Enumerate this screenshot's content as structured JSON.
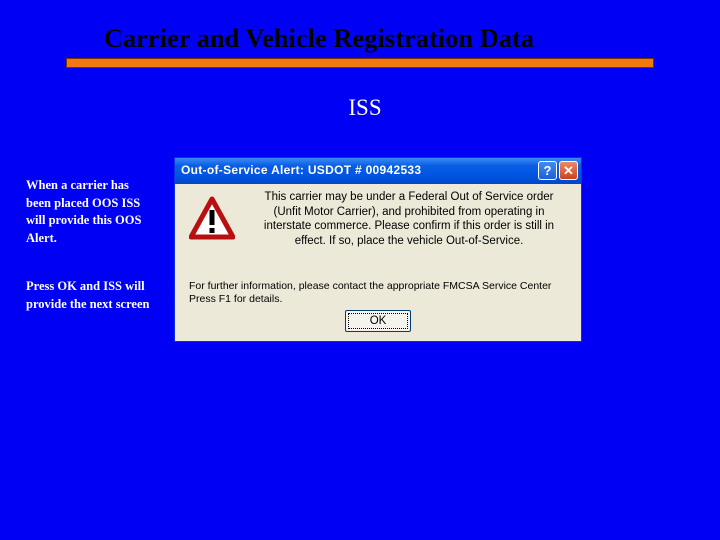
{
  "slide": {
    "title": "Carrier and Vehicle Registration Data",
    "subtitle": "ISS",
    "notes": [
      "When a carrier has been placed OOS ISS will provide this OOS Alert.",
      "Press OK and ISS will provide the next screen"
    ],
    "colors": {
      "background": "#0000f4",
      "underline": "#f07a10"
    }
  },
  "dialog": {
    "title": "Out-of-Service Alert:  USDOT # 00942533",
    "help_label": "?",
    "close_label": "✕",
    "icon": "warning-icon",
    "message": "This carrier may be under a Federal Out of Service order (Unfit Motor Carrier), and prohibited from operating in interstate commerce. Please confirm if this order is still in effect. If so, place the vehicle Out-of-Service.",
    "info_line1": "For further information, please contact the appropriate FMCSA Service Center",
    "info_line2": "Press F1 for details.",
    "ok_label": "OK",
    "colors": {
      "titlebar": "#0054e3",
      "body": "#ece9d8"
    }
  }
}
